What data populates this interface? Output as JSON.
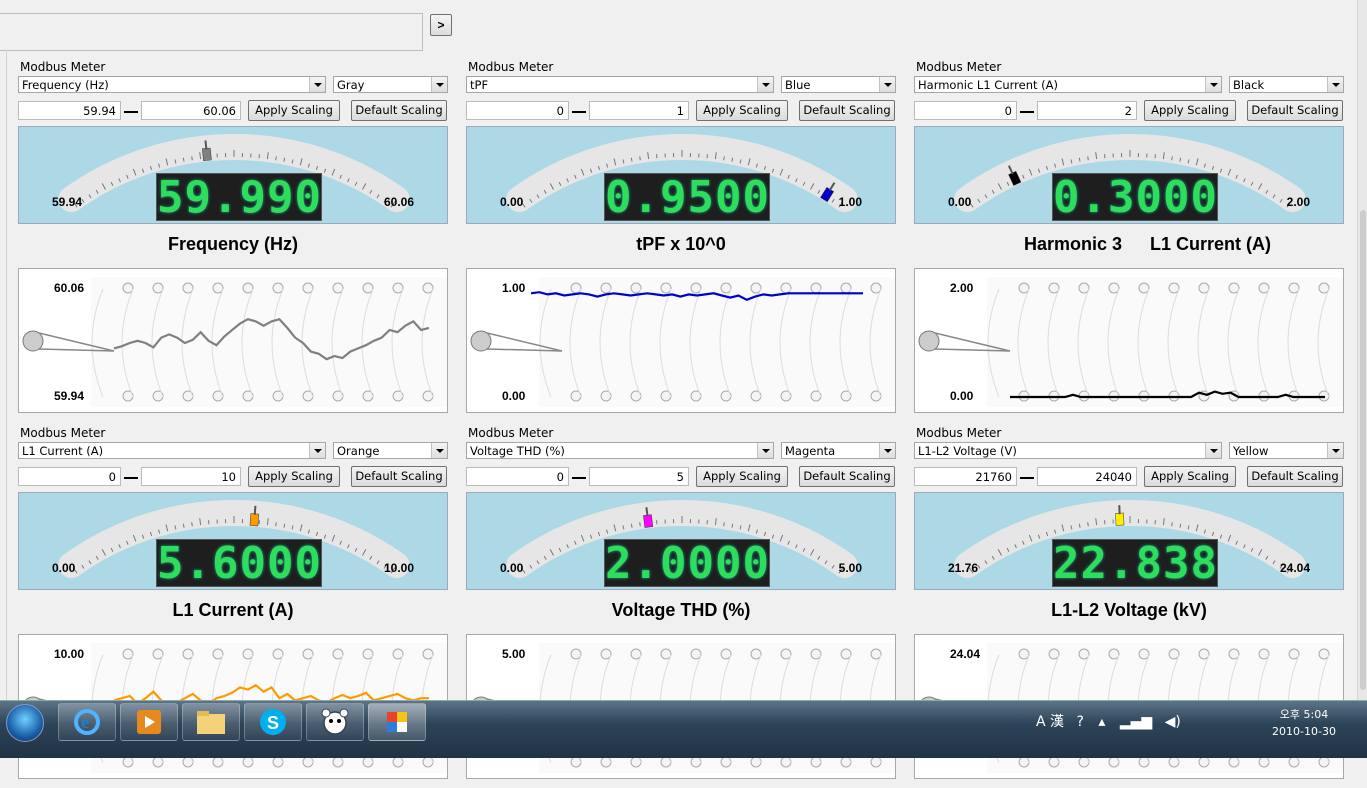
{
  "toolbar": {
    "go_label": ">"
  },
  "common": {
    "apply_label": "Apply Scaling",
    "default_label": "Default Scaling",
    "section_label": "Modbus Meter"
  },
  "panels": [
    {
      "source": "Frequency (Hz)",
      "color_name": "Gray",
      "color": "#808080",
      "min_field": "59.94",
      "max_field": "60.06",
      "min_label": "59.94",
      "max_label": "60.06",
      "reading": "59.990",
      "level": 0.42,
      "title": "Frequency (Hz)",
      "title_left": "",
      "title_right": "",
      "trend_max": "60.06",
      "trend_min": "59.94",
      "trend": [
        0.45,
        0.47,
        0.5,
        0.52,
        0.5,
        0.46,
        0.55,
        0.58,
        0.55,
        0.5,
        0.53,
        0.6,
        0.52,
        0.48,
        0.56,
        0.62,
        0.68,
        0.72,
        0.7,
        0.66,
        0.7,
        0.72,
        0.64,
        0.55,
        0.5,
        0.42,
        0.4,
        0.35,
        0.38,
        0.36,
        0.42,
        0.45,
        0.48,
        0.52,
        0.55,
        0.62,
        0.6,
        0.66,
        0.7,
        0.62,
        0.64
      ]
    },
    {
      "source": "tPF",
      "color_name": "Blue",
      "color": "#0000cc",
      "min_field": "0",
      "max_field": "1",
      "min_label": "0.00",
      "max_label": "1.00",
      "reading": "0.9500",
      "level": 0.95,
      "title": "tPF x 10^0",
      "title_left": "",
      "title_right": "",
      "trend_max": "1.00",
      "trend_min": "0.00",
      "trend": [
        0.96,
        0.97,
        0.95,
        0.96,
        0.94,
        0.95,
        0.96,
        0.95,
        0.93,
        0.95,
        0.96,
        0.95,
        0.94,
        0.95,
        0.96,
        0.95,
        0.94,
        0.95,
        0.93,
        0.95,
        0.94,
        0.95,
        0.96,
        0.94,
        0.92,
        0.94,
        0.9,
        0.93,
        0.95,
        0.94,
        0.95,
        0.96,
        0.96,
        0.96,
        0.96,
        0.96,
        0.96,
        0.96,
        0.96,
        0.96,
        0.96
      ]
    },
    {
      "source": "Harmonic L1 Current (A)",
      "color_name": "Black",
      "color": "#000000",
      "min_field": "0",
      "max_field": "2",
      "min_label": "0.00",
      "max_label": "2.00",
      "reading": "0.3000",
      "level": 0.15,
      "title": "",
      "title_left": "Harmonic 3",
      "title_right": "L1 Current (A)",
      "trend_max": "2.00",
      "trend_min": "0.00",
      "trend": [
        0.0,
        0.0,
        0.0,
        0.0,
        0.0,
        0.0,
        0.0,
        0.0,
        0.02,
        0.0,
        0.0,
        0.0,
        0.0,
        0.0,
        0.0,
        0.0,
        0.0,
        0.0,
        0.0,
        0.0,
        0.0,
        0.0,
        0.0,
        0.0,
        0.04,
        0.02,
        0.05,
        0.03,
        0.04,
        0.0,
        0.0,
        0.0,
        0.0,
        0.0,
        0.0,
        0.02,
        0.0,
        0.0,
        0.0,
        0.0,
        0.0
      ]
    },
    {
      "source": "L1 Current (A)",
      "color_name": "Orange",
      "color": "#ff9900",
      "min_field": "0",
      "max_field": "10",
      "min_label": "0.00",
      "max_label": "10.00",
      "reading": "5.6000",
      "level": 0.56,
      "title": "L1 Current (A)",
      "title_left": "",
      "title_right": "",
      "trend_max": "10.00",
      "trend_min": "",
      "trend": [
        0.58,
        0.6,
        0.62,
        0.55,
        0.6,
        0.66,
        0.58,
        0.52,
        0.56,
        0.6,
        0.64,
        0.58,
        0.55,
        0.6,
        0.62,
        0.65,
        0.7,
        0.68,
        0.72,
        0.66,
        0.7,
        0.6,
        0.64,
        0.58,
        0.6,
        0.62,
        0.58,
        0.56,
        0.6,
        0.63,
        0.6,
        0.62,
        0.65,
        0.58,
        0.6,
        0.62,
        0.64,
        0.6,
        0.58,
        0.6,
        0.6
      ]
    },
    {
      "source": "Voltage THD (%)",
      "color_name": "Magenta",
      "color": "#ff00ff",
      "min_field": "0",
      "max_field": "5",
      "min_label": "0.00",
      "max_label": "5.00",
      "reading": "2.0000",
      "level": 0.4,
      "title": "Voltage THD (%)",
      "title_left": "",
      "title_right": "",
      "trend_max": "5.00",
      "trend_min": "",
      "trend": [
        0.4,
        0.4,
        0.4,
        0.4,
        0.4,
        0.4,
        0.4,
        0.4,
        0.4,
        0.4,
        0.4,
        0.4,
        0.4,
        0.4,
        0.4,
        0.4,
        0.4,
        0.4,
        0.4,
        0.4,
        0.4,
        0.4,
        0.4,
        0.4,
        0.4,
        0.4,
        0.4,
        0.4,
        0.4,
        0.4,
        0.4,
        0.4,
        0.4,
        0.4,
        0.4,
        0.4,
        0.4,
        0.4,
        0.4,
        0.4,
        0.4
      ]
    },
    {
      "source": "L1-L2 Voltage (V)",
      "color_name": "Yellow",
      "color": "#ffee00",
      "min_field": "21760",
      "max_field": "24040",
      "min_label": "21.76",
      "max_label": "24.04",
      "reading": "22.838",
      "level": 0.47,
      "title": "L1-L2 Voltage (kV)",
      "title_left": "",
      "title_right": "",
      "trend_max": "24.04",
      "trend_min": "",
      "trend": []
    }
  ],
  "taskbar": {
    "time": "오후 5:04",
    "date": "2010-10-30",
    "ime": "A 漢"
  }
}
